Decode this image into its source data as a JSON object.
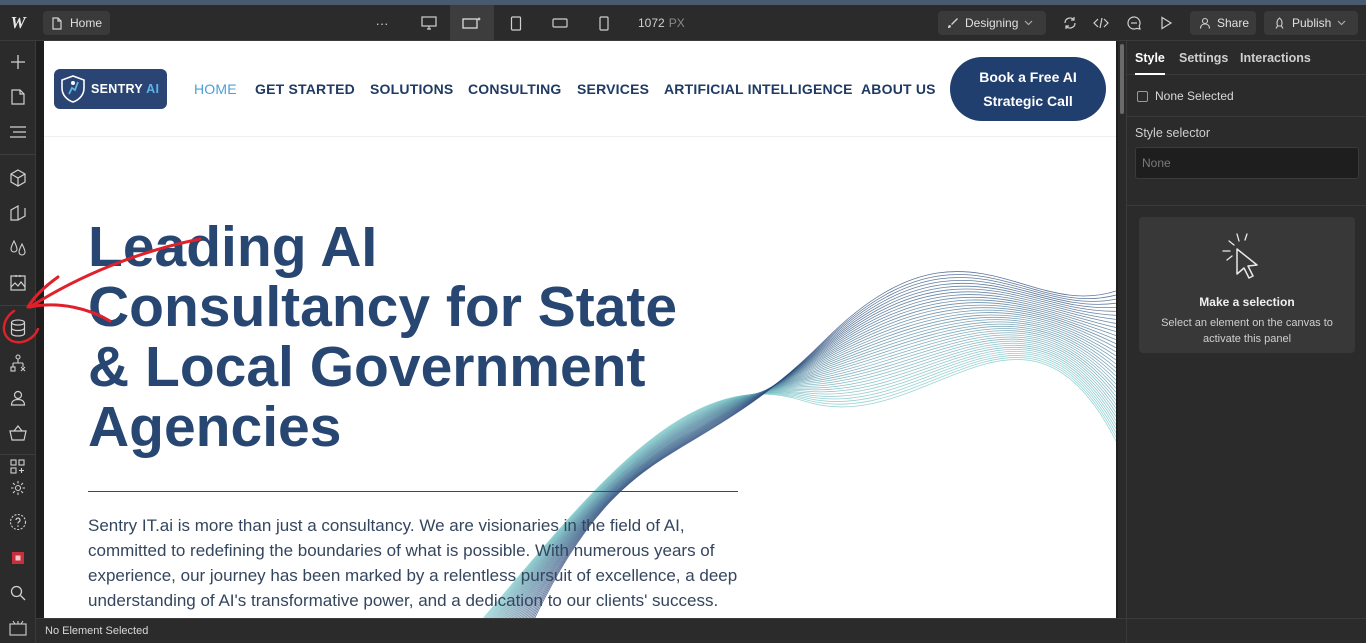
{
  "topbar": {
    "logo": "W",
    "page_name": "Home",
    "more_label": "···",
    "width_value": "1072",
    "width_unit": "PX",
    "mode_label": "Designing",
    "share_label": "Share",
    "publish_label": "Publish"
  },
  "site": {
    "brand": "SENTRY",
    "brand_ai": "AI",
    "nav": [
      "HOME",
      "GET STARTED",
      "SOLUTIONS",
      "CONSULTING",
      "SERVICES",
      "ARTIFICIAL INTELLIGENCE",
      "ABOUT US"
    ],
    "cta_line1": "Book a Free AI",
    "cta_line2": "Strategic Call",
    "hero_line1": "Leading AI",
    "hero_line2": "Consultancy for State",
    "hero_line3": "& Local Government",
    "hero_line4": "Agencies",
    "body": "Sentry IT.ai is more than just a consultancy.  We are visionaries in the field of AI, committed to redefining the boundaries of what is possible. With numerous years of experience, our journey has been marked by a relentless pursuit of excellence, a deep understanding of AI's transformative power, and a dedication to our clients' success. We leverage the power of AI to solve your most pressing challenges and drive"
  },
  "right_panel": {
    "tabs": [
      "Style",
      "Settings",
      "Interactions"
    ],
    "none_selected": "None Selected",
    "style_selector_label": "Style selector",
    "style_selector_placeholder": "None",
    "card_title": "Make a selection",
    "card_desc": "Select an element on the canvas to activate this panel"
  },
  "status": {
    "text": "No Element Selected"
  },
  "colors": {
    "navy": "#274672",
    "link_active": "#4c9fd6",
    "annotation": "#e0202a"
  }
}
